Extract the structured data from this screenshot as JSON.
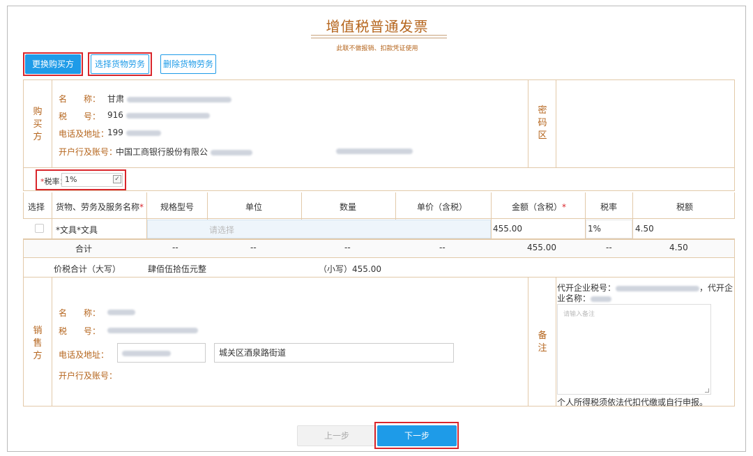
{
  "invoice": {
    "title": "增值税普通发票",
    "subtitle": "此联不做报销、扣款凭证使用"
  },
  "toolbar": {
    "change_buyer": "更换购买方",
    "select_goods": "选择货物劳务",
    "delete_goods": "删除货物劳务"
  },
  "buyer": {
    "section_label": [
      "购",
      "买",
      "方"
    ],
    "name_label": "名　　称：",
    "name_value": "甘肃",
    "tax_label": "税　　号：",
    "tax_value": "916",
    "addr_label": "电话及地址：",
    "addr_value": "199",
    "bank_label": "开户行及账号：",
    "bank_value": "中国工商银行股份有限公"
  },
  "password_area": {
    "label": [
      "密",
      "码",
      "区"
    ]
  },
  "tax_rate": {
    "label": "税率：",
    "required_mark": "*",
    "value": "1%"
  },
  "table": {
    "headers": {
      "select": "选择",
      "name": "货物、劳务及服务名称",
      "spec": "规格型号",
      "unit": "单位",
      "qty": "数量",
      "price": "单价（含税）",
      "amount": "金额（含税）",
      "rate": "税率",
      "tax": "税额"
    },
    "required_mark": "*",
    "rows": [
      {
        "name": "*文具*文具",
        "unit_placeholder": "请选择",
        "amount": "455.00",
        "rate": "1%",
        "tax": "4.50"
      }
    ],
    "total": {
      "label": "合计",
      "spec": "--",
      "unit": "--",
      "qty": "--",
      "price": "--",
      "amount": "455.00",
      "rate": "--",
      "tax": "4.50"
    },
    "grand_total": {
      "label": "价税合计（大写）",
      "uppercase": "肆佰伍拾伍元整",
      "lowercase_label": "（小写）",
      "lowercase": "455.00"
    }
  },
  "seller": {
    "section_label": [
      "销",
      "售",
      "方"
    ],
    "name_label": "名　　称：",
    "tax_label": "税　　号：",
    "addr_label": "电话及地址：",
    "address": "城关区酒泉路街道",
    "bank_label": "开户行及账号："
  },
  "remark": {
    "section_label": [
      "备",
      "注"
    ],
    "agent_tax_label": "代开企业税号：",
    "agent_suffix": "，代开企",
    "agent_name_label": "业名称：",
    "placeholder": "请输入备注",
    "note": "个人所得税须依法代扣代缴或自行申报。"
  },
  "footer": {
    "prev": "上一步",
    "next": "下一步"
  },
  "colors": {
    "brand": "#1e9be8",
    "label_brown": "#b5651d",
    "highlight_red": "#d9262c"
  }
}
